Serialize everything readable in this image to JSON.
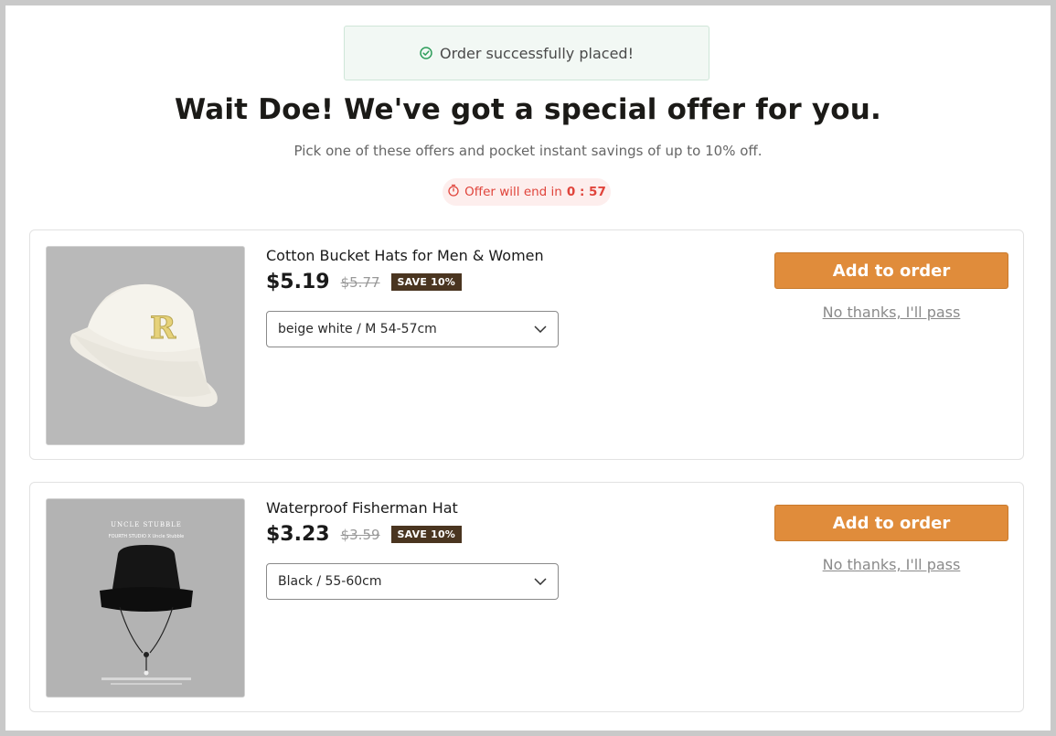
{
  "banner": {
    "text": "Order successfully placed!",
    "icon": "check-circle-icon",
    "color": "#2f9e5b"
  },
  "headline": "Wait Doe! We've got a special offer for you.",
  "subline": "Pick one of these offers and pocket instant savings of up to 10% off.",
  "timer": {
    "label": "Offer will end in",
    "value": "0 : 57",
    "icon": "stopwatch-icon",
    "color": "#e0443b"
  },
  "accent_color": "#e08c3b",
  "offers": [
    {
      "title": "Cotton Bucket Hats for Men & Women",
      "price": "$5.19",
      "old_price": "$5.77",
      "badge": "SAVE 10%",
      "variant": "beige white / M 54-57cm",
      "add_label": "Add to order",
      "pass_label": "No thanks, I'll pass",
      "image": "beige-bucket-hat-image"
    },
    {
      "title": "Waterproof Fisherman Hat",
      "price": "$3.23",
      "old_price": "$3.59",
      "badge": "SAVE 10%",
      "variant": "Black / 55-60cm",
      "add_label": "Add to order",
      "pass_label": "No thanks, I'll pass",
      "image": "black-fisherman-hat-image",
      "image_text": {
        "brand": "UNCLE STUBBLE",
        "collab": "FOURTH STUDIO  X  Uncle Stubble"
      }
    }
  ]
}
